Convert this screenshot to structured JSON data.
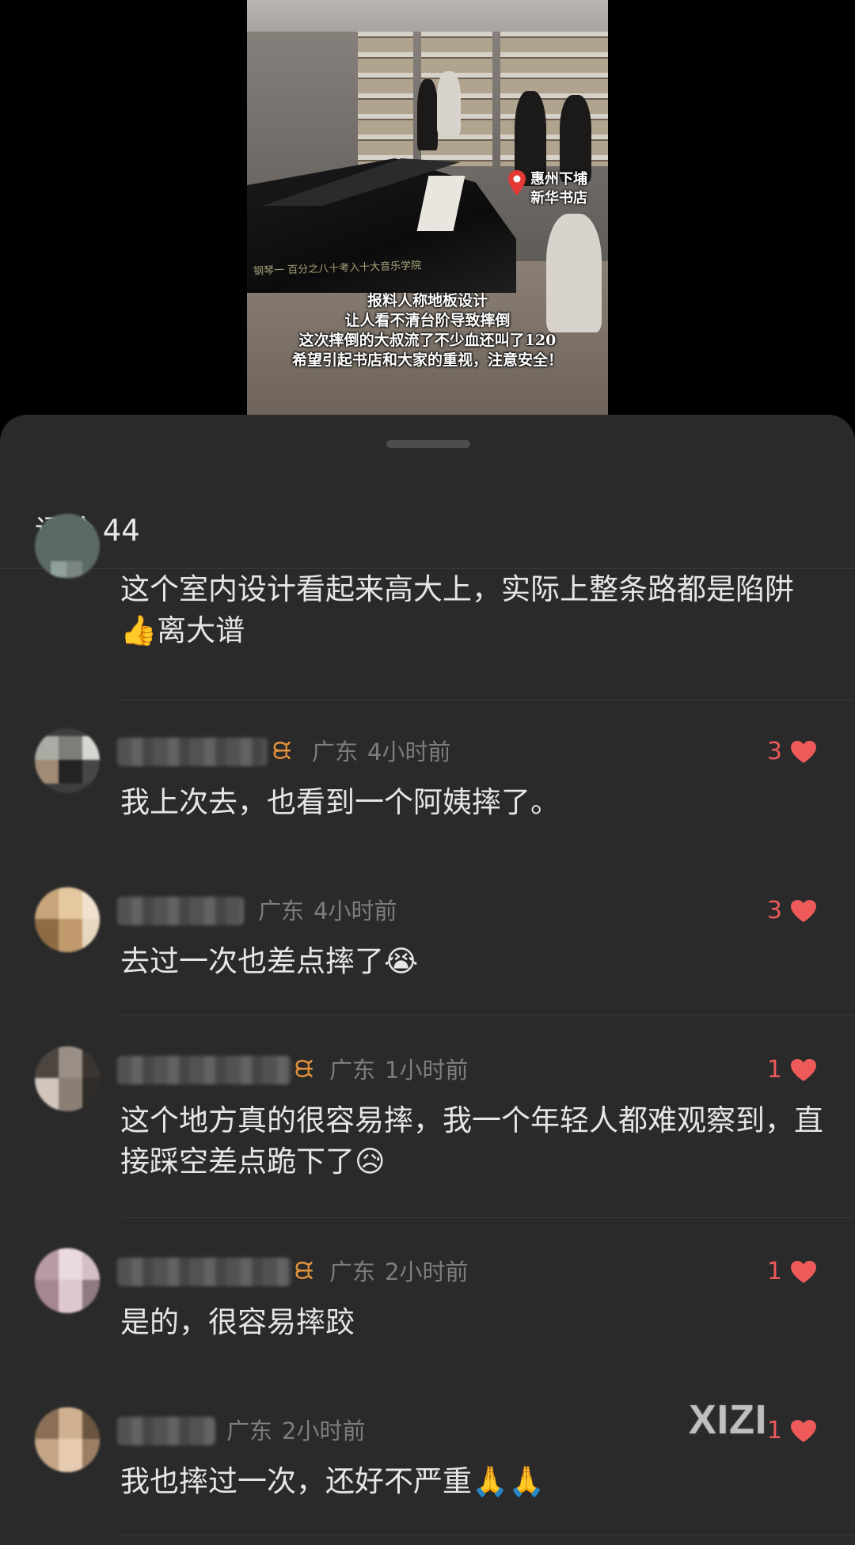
{
  "video": {
    "location_text": "惠州下埔\n新华书店",
    "caption_lines": [
      "报料人称地板设计",
      "让人看不清台阶导致摔倒",
      "这次摔倒的大叔流了不少血还叫了120",
      "希望引起书店和大家的重视，注意安全！"
    ],
    "banner_text": "钢琴一 百分之八十考入十大音乐学院"
  },
  "comments_header": "评论 44",
  "comments": [
    {
      "text": "这个室内设计看起来高大上，实际上整条路都是陷阱👍离大谱"
    },
    {
      "region": "广东",
      "time": "4小时前",
      "likes": "3",
      "text": "我上次去，也看到一个阿姨摔了。"
    },
    {
      "region": "广东",
      "time": "4小时前",
      "likes": "3",
      "text": "去过一次也差点摔了😭"
    },
    {
      "region": "广东",
      "time": "1小时前",
      "likes": "1",
      "text": "这个地方真的很容易摔，我一个年轻人都难观察到，直接踩空差点跪下了😥"
    },
    {
      "region": "广东",
      "time": "2小时前",
      "likes": "1",
      "text": "是的，很容易摔跤"
    },
    {
      "region": "广东",
      "time": "2小时前",
      "likes": "1",
      "text": "我也摔过一次，还好不严重🙏🙏"
    }
  ],
  "watermark": "XIZI",
  "colors": {
    "sheet_bg": "#2a2a2a",
    "like_red": "#ee5a5a",
    "vip_orange": "#e0913b",
    "meta_gray": "#7d7d7d"
  },
  "icons": {
    "location": "location-pin-icon",
    "like": "heart-icon",
    "vip": "vip-badge-icon"
  }
}
